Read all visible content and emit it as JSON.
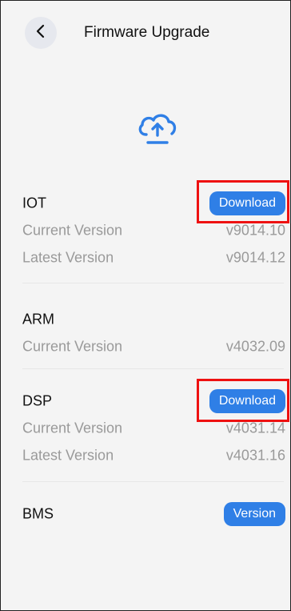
{
  "header": {
    "title": "Firmware Upgrade"
  },
  "icons": {
    "back": "chevron-left-icon",
    "upload": "cloud-upload-icon"
  },
  "colors": {
    "accent": "#2f7fe6",
    "highlight": "#ee1111",
    "muted_text": "#9a9a9a"
  },
  "sections": {
    "iot": {
      "name": "IOT",
      "action": "Download",
      "current_label": "Current Version",
      "current_value": "v9014.10",
      "latest_label": "Latest Version",
      "latest_value": "v9014.12"
    },
    "arm": {
      "name": "ARM",
      "current_label": "Current Version",
      "current_value": "v4032.09"
    },
    "dsp": {
      "name": "DSP",
      "action": "Download",
      "current_label": "Current Version",
      "current_value": "v4031.14",
      "latest_label": "Latest Version",
      "latest_value": "v4031.16"
    },
    "bms": {
      "name": "BMS",
      "action": "Version"
    }
  }
}
